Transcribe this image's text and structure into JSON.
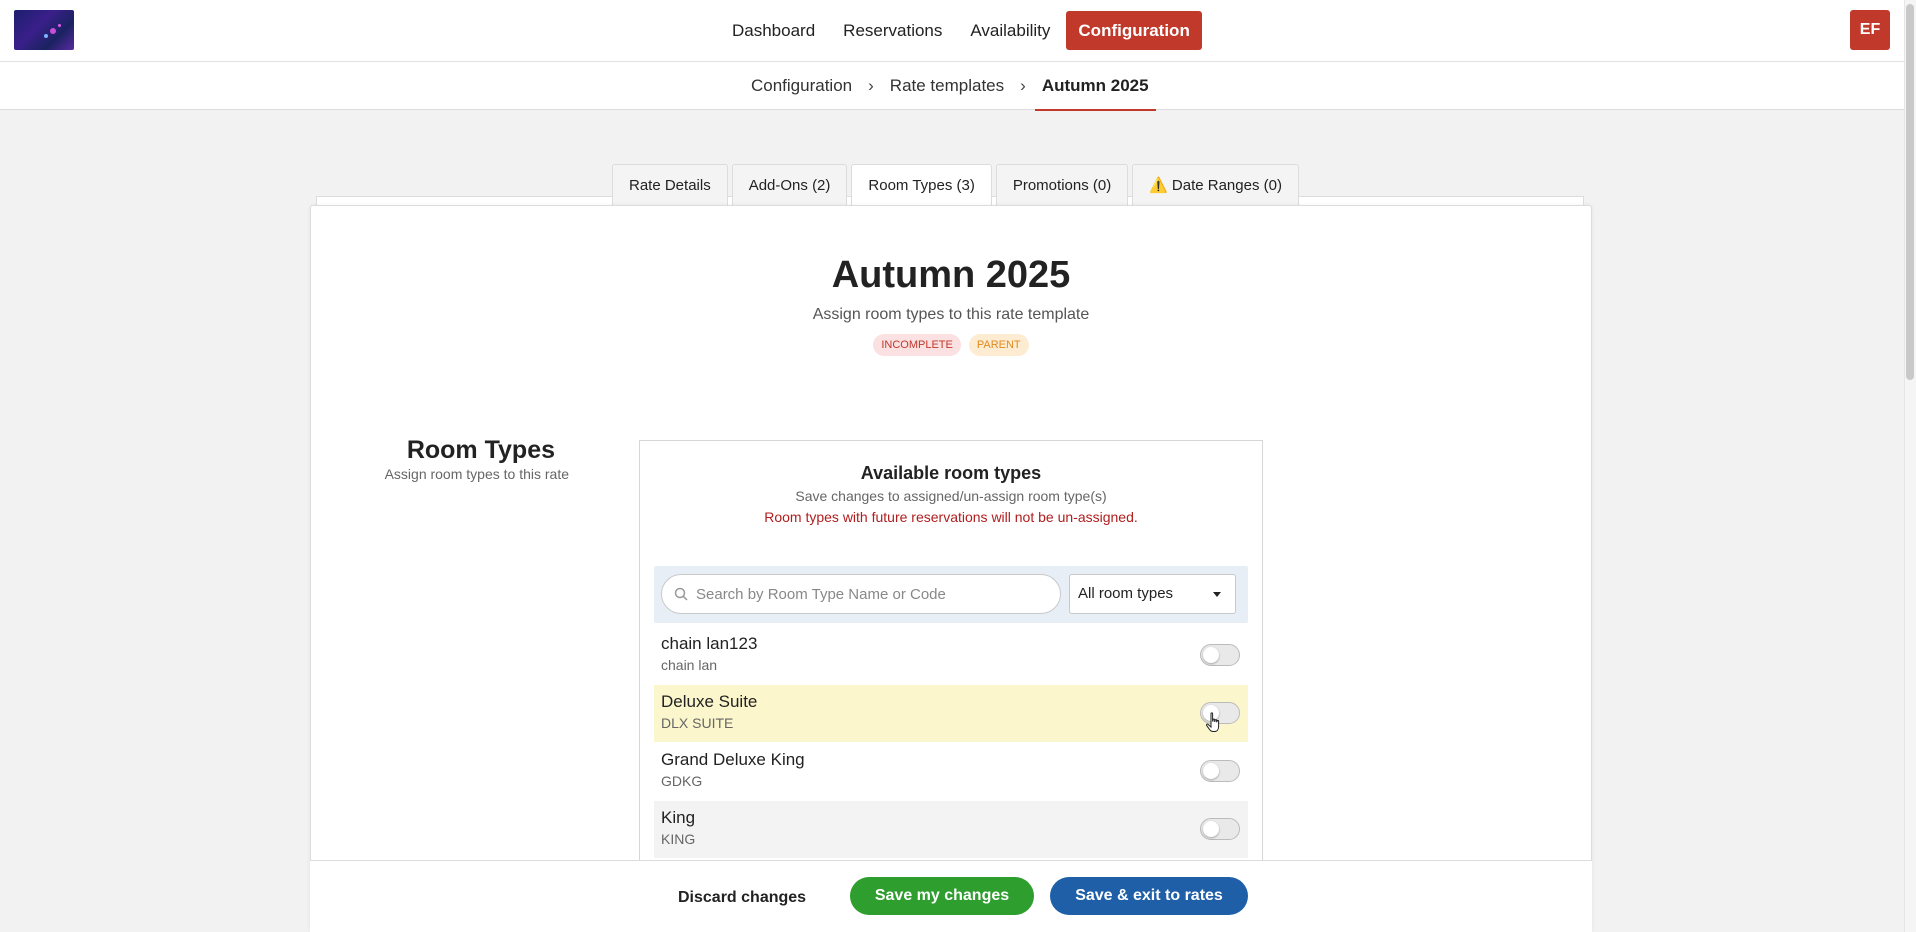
{
  "nav": {
    "items": [
      {
        "label": "Dashboard",
        "active": false
      },
      {
        "label": "Reservations",
        "active": false
      },
      {
        "label": "Availability",
        "active": false
      },
      {
        "label": "Configuration",
        "active": true
      }
    ],
    "avatar_initials": "EF"
  },
  "breadcrumb": {
    "items": [
      "Configuration",
      "Rate templates",
      "Autumn 2025"
    ],
    "separator": "›"
  },
  "tabs": [
    {
      "label": "Rate Details",
      "active": false,
      "warning": false
    },
    {
      "label": "Add-Ons (2)",
      "active": false,
      "warning": false
    },
    {
      "label": "Room Types (3)",
      "active": true,
      "warning": false
    },
    {
      "label": "Promotions (0)",
      "active": false,
      "warning": false
    },
    {
      "label": "Date Ranges (0)",
      "active": false,
      "warning": true,
      "warning_glyph": "⚠️"
    }
  ],
  "header": {
    "title": "Autumn 2025",
    "subtitle": "Assign room types to this rate template",
    "badges": [
      "INCOMPLETE",
      "PARENT"
    ]
  },
  "section": {
    "title": "Room Types",
    "subtitle": "Assign room types to this rate"
  },
  "panel": {
    "title": "Available room types",
    "subtitle": "Save changes to assigned/un-assign room type(s)",
    "warning": "Room types with future reservations will not be un-assigned.",
    "search_placeholder": "Search by Room Type Name or Code",
    "filter_value": "All room types"
  },
  "room_types": [
    {
      "name": "chain lan123",
      "code": "chain lan",
      "assigned": false
    },
    {
      "name": "Deluxe Suite",
      "code": "DLX SUITE",
      "assigned": false
    },
    {
      "name": "Grand Deluxe King",
      "code": "GDKG",
      "assigned": false
    },
    {
      "name": "King",
      "code": "KING",
      "assigned": false
    }
  ],
  "footer": {
    "discard_label": "Discard changes",
    "save_label": "Save my changes",
    "save_exit_label": "Save & exit to rates"
  },
  "colors": {
    "brand_red": "#c0392b",
    "save_green": "#2e9e2e",
    "exit_blue": "#1f5fa8",
    "hover_row": "#fbf6cc"
  }
}
